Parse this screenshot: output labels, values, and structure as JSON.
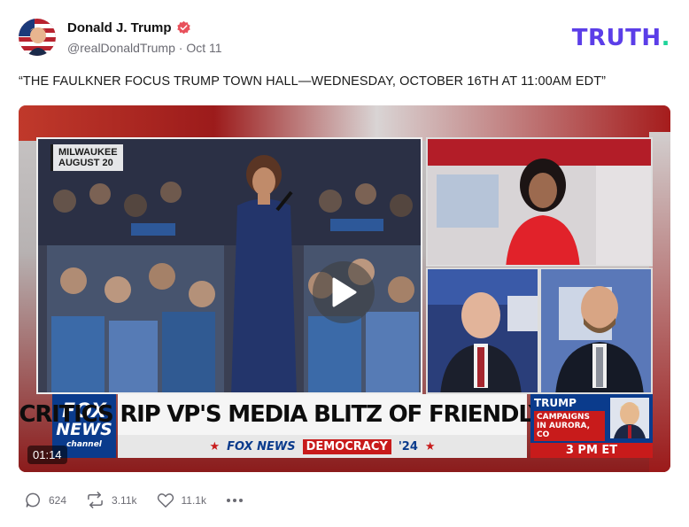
{
  "post": {
    "author_name": "Donald J. Trump",
    "handle": "@realDonaldTrump",
    "separator": "·",
    "date": "Oct 11",
    "brand": "TRUTH",
    "brand_dot": ".",
    "text": "“THE FAULKNER FOCUS TRUMP TOWN HALL—WEDNESDAY, OCTOBER 16TH AT 11:00AM EDT”"
  },
  "video": {
    "duration": "01:14",
    "location_tag_line1": "MILWAUKEE",
    "location_tag_line2": "AUGUST 20",
    "network_logo_line1": "FOX",
    "network_logo_line2": "NEWS",
    "network_logo_line3": "channel",
    "headline": "CRITICS RIP VP'S MEDIA BLITZ OF FRIENDLY FACES",
    "ticker_network": "FOX NEWS",
    "ticker_segment": "DEMOCRACY",
    "ticker_year": "'24",
    "promo_name": "TRUMP",
    "promo_sub": "CAMPAIGNS IN AURORA, CO",
    "promo_time": "3 PM ET"
  },
  "actions": {
    "replies": "624",
    "retruths": "3.11k",
    "likes": "11.1k"
  },
  "colors": {
    "brand": "#5b3ee8",
    "brand_dot": "#1fd49a",
    "verified": "#e8505b",
    "muted_text": "#6b6b73"
  },
  "icons": [
    "verified-badge-icon",
    "reply-icon",
    "retruth-icon",
    "like-icon",
    "more-icon",
    "play-icon"
  ]
}
